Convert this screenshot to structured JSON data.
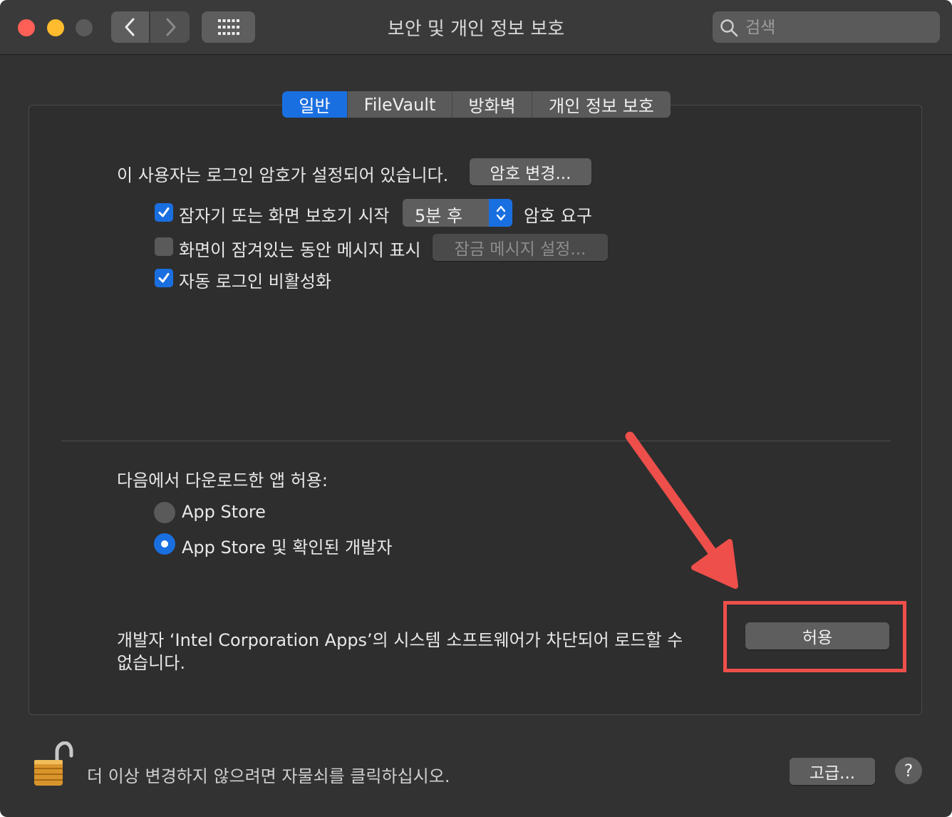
{
  "window": {
    "title": "보안 및 개인 정보 보호",
    "search_placeholder": "검색"
  },
  "tabs": [
    {
      "label": "일반",
      "active": true
    },
    {
      "label": "FileVault",
      "active": false
    },
    {
      "label": "방화벽",
      "active": false
    },
    {
      "label": "개인 정보 보호",
      "active": false
    }
  ],
  "general": {
    "login_password_text": "이 사용자는 로그인 암호가 설정되어 있습니다.",
    "change_password_button": "암호 변경...",
    "require_password": {
      "checked": true,
      "label": "잠자기 또는 화면 보호기 시작",
      "select_value": "5분 후",
      "suffix": "암호 요구"
    },
    "show_message": {
      "checked": false,
      "label": "화면이 잠겨있는 동안 메시지 표시",
      "button": "잠금 메시지 설정..."
    },
    "disable_autologin": {
      "checked": true,
      "label": "자동 로그인 비활성화"
    }
  },
  "downloads": {
    "heading": "다음에서 다운로드한 앱 허용:",
    "options": [
      {
        "label": "App Store",
        "selected": false
      },
      {
        "label": "App Store 및 확인된 개발자",
        "selected": true
      }
    ]
  },
  "blocked": {
    "line1": "개발자 ‘Intel Corporation Apps’의 시스템 소프트웨어가 차단되어 로드할 수",
    "line2": "없습니다.",
    "allow_button": "허용"
  },
  "footer": {
    "lock_text": "더 이상 변경하지 않으려면 자물쇠를 클릭하십시오.",
    "advanced_button": "고급...",
    "help_label": "?"
  },
  "colors": {
    "accent": "#1a6fe0",
    "annotation": "#ee4f4a",
    "window_bg": "#323232"
  }
}
